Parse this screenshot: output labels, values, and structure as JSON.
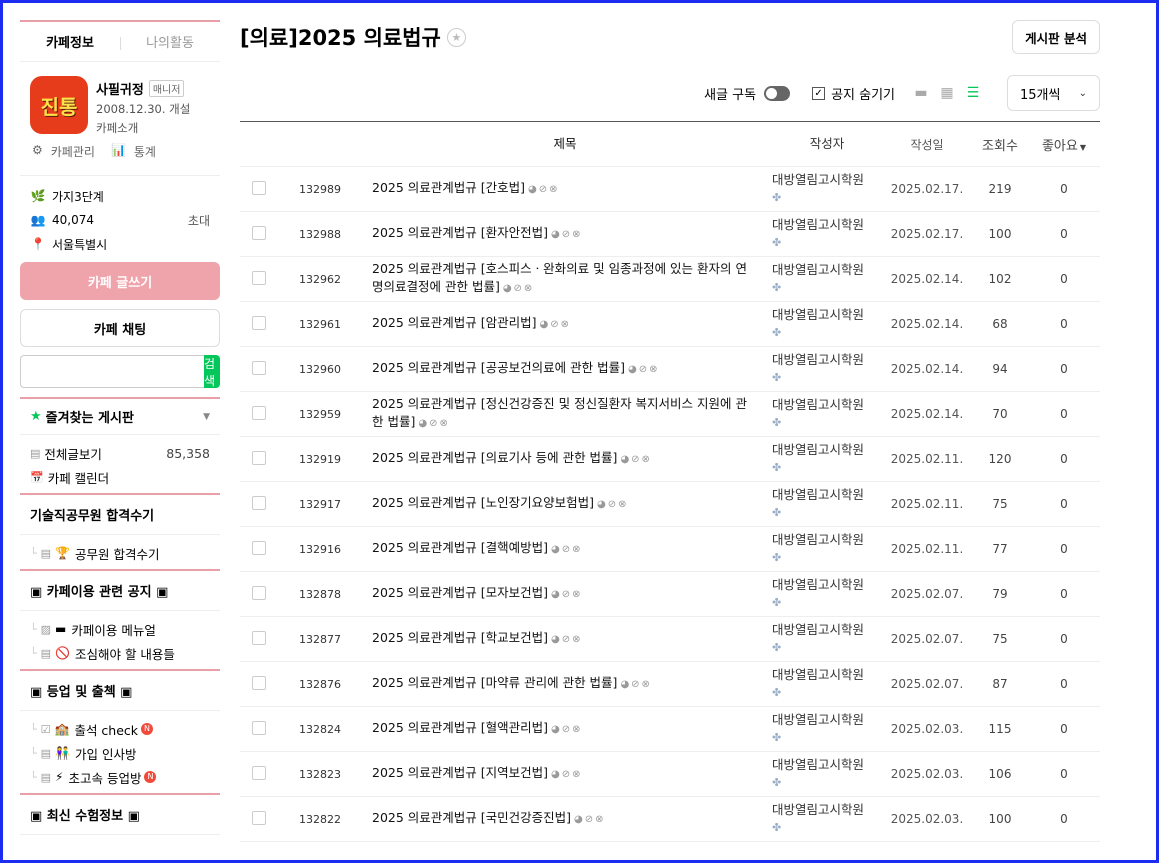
{
  "sidebar": {
    "tabs": [
      "카페정보",
      "나의활동"
    ],
    "cafe": {
      "logo_text": "진통",
      "name": "사필귀정",
      "role": "매니저",
      "established": "2008.12.30. 개설",
      "intro": "카페소개"
    },
    "mgmt": [
      "카페관리",
      "통계"
    ],
    "stats": {
      "level": "가지3단계",
      "members": "40,074",
      "invite": "초대",
      "location": "서울특별시"
    },
    "write_label": "카페 글쓰기",
    "chat_label": "카페 채팅",
    "search": {
      "placeholder": "",
      "button": "검색"
    },
    "favorites": {
      "title": "즐겨찾는 게시판"
    },
    "all_posts": {
      "label": "전체글보기",
      "count": "85,358"
    },
    "calendar": "카페 캘린더",
    "groups": [
      {
        "title": "기술직공무원 합격수기",
        "items": [
          {
            "emo": "🏆",
            "label": "공무원 합격수기",
            "new": false
          }
        ]
      },
      {
        "title": "▣ 카페이용 관련 공지 ▣",
        "items": [
          {
            "emo": "▬",
            "label": "카페이용 메뉴얼",
            "new": false
          },
          {
            "emo": "🚫",
            "label": "조심해야 할 내용들",
            "new": false
          }
        ]
      },
      {
        "title": "▣ 등업 및 출첵 ▣",
        "items": [
          {
            "emo": "🏫",
            "label": "출석 check",
            "new": true
          },
          {
            "emo": "👫",
            "label": "가입 인사방",
            "new": false
          },
          {
            "emo": "⚡",
            "label": "초고속 등업방",
            "new": true
          }
        ]
      },
      {
        "title": "▣ 최신 수험정보 ▣",
        "items": []
      }
    ],
    "new_badge": "N"
  },
  "main": {
    "board_title": "[의료]2025 의료법규",
    "analyze_label": "게시판 분석",
    "subscribe_label": "새글 구독",
    "hide_notice_label": "공지 숨기기",
    "per_page": "15개씩",
    "columns": {
      "title": "제목",
      "author": "작성자",
      "date": "작성일",
      "views": "조회수",
      "likes": "좋아요"
    },
    "rows": [
      {
        "num": "132989",
        "title": "2025 의료관계법규 [간호법]",
        "author": "대방열림고시학원",
        "date": "2025.02.17.",
        "views": "219",
        "likes": "0"
      },
      {
        "num": "132988",
        "title": "2025 의료관계법규 [환자안전법]",
        "author": "대방열림고시학원",
        "date": "2025.02.17.",
        "views": "100",
        "likes": "0"
      },
      {
        "num": "132962",
        "title": "2025 의료관계법규 [호스피스ㆍ완화의료 및 임종과정에 있는 환자의 연명의료결정에 관한 법률]",
        "author": "대방열림고시학원",
        "date": "2025.02.14.",
        "views": "102",
        "likes": "0"
      },
      {
        "num": "132961",
        "title": "2025 의료관계법규 [암관리법]",
        "author": "대방열림고시학원",
        "date": "2025.02.14.",
        "views": "68",
        "likes": "0"
      },
      {
        "num": "132960",
        "title": "2025 의료관계법규 [공공보건의료에 관한 법률]",
        "author": "대방열림고시학원",
        "date": "2025.02.14.",
        "views": "94",
        "likes": "0"
      },
      {
        "num": "132959",
        "title": "2025 의료관계법규 [정신건강증진 및 정신질환자 복지서비스 지원에 관한 법률]",
        "author": "대방열림고시학원",
        "date": "2025.02.14.",
        "views": "70",
        "likes": "0"
      },
      {
        "num": "132919",
        "title": "2025 의료관계법규 [의료기사 등에 관한 법률]",
        "author": "대방열림고시학원",
        "date": "2025.02.11.",
        "views": "120",
        "likes": "0"
      },
      {
        "num": "132917",
        "title": "2025 의료관계법규 [노인장기요양보험법]",
        "author": "대방열림고시학원",
        "date": "2025.02.11.",
        "views": "75",
        "likes": "0"
      },
      {
        "num": "132916",
        "title": "2025 의료관계법규 [결핵예방법]",
        "author": "대방열림고시학원",
        "date": "2025.02.11.",
        "views": "77",
        "likes": "0"
      },
      {
        "num": "132878",
        "title": "2025 의료관계법규 [모자보건법]",
        "author": "대방열림고시학원",
        "date": "2025.02.07.",
        "views": "79",
        "likes": "0"
      },
      {
        "num": "132877",
        "title": "2025 의료관계법규 [학교보건법]",
        "author": "대방열림고시학원",
        "date": "2025.02.07.",
        "views": "75",
        "likes": "0"
      },
      {
        "num": "132876",
        "title": "2025 의료관계법규 [마약류 관리에 관한 법률]",
        "author": "대방열림고시학원",
        "date": "2025.02.07.",
        "views": "87",
        "likes": "0"
      },
      {
        "num": "132824",
        "title": "2025 의료관계법규 [혈액관리법]",
        "author": "대방열림고시학원",
        "date": "2025.02.03.",
        "views": "115",
        "likes": "0"
      },
      {
        "num": "132823",
        "title": "2025 의료관계법규 [지역보건법]",
        "author": "대방열림고시학원",
        "date": "2025.02.03.",
        "views": "106",
        "likes": "0"
      },
      {
        "num": "132822",
        "title": "2025 의료관계법규 [국민건강증진법]",
        "author": "대방열림고시학원",
        "date": "2025.02.03.",
        "views": "100",
        "likes": "0"
      }
    ]
  },
  "colors": {
    "accent_pink": "#efa3ab",
    "naver_green": "#03c75a",
    "frame_blue": "#1c2cf0"
  }
}
